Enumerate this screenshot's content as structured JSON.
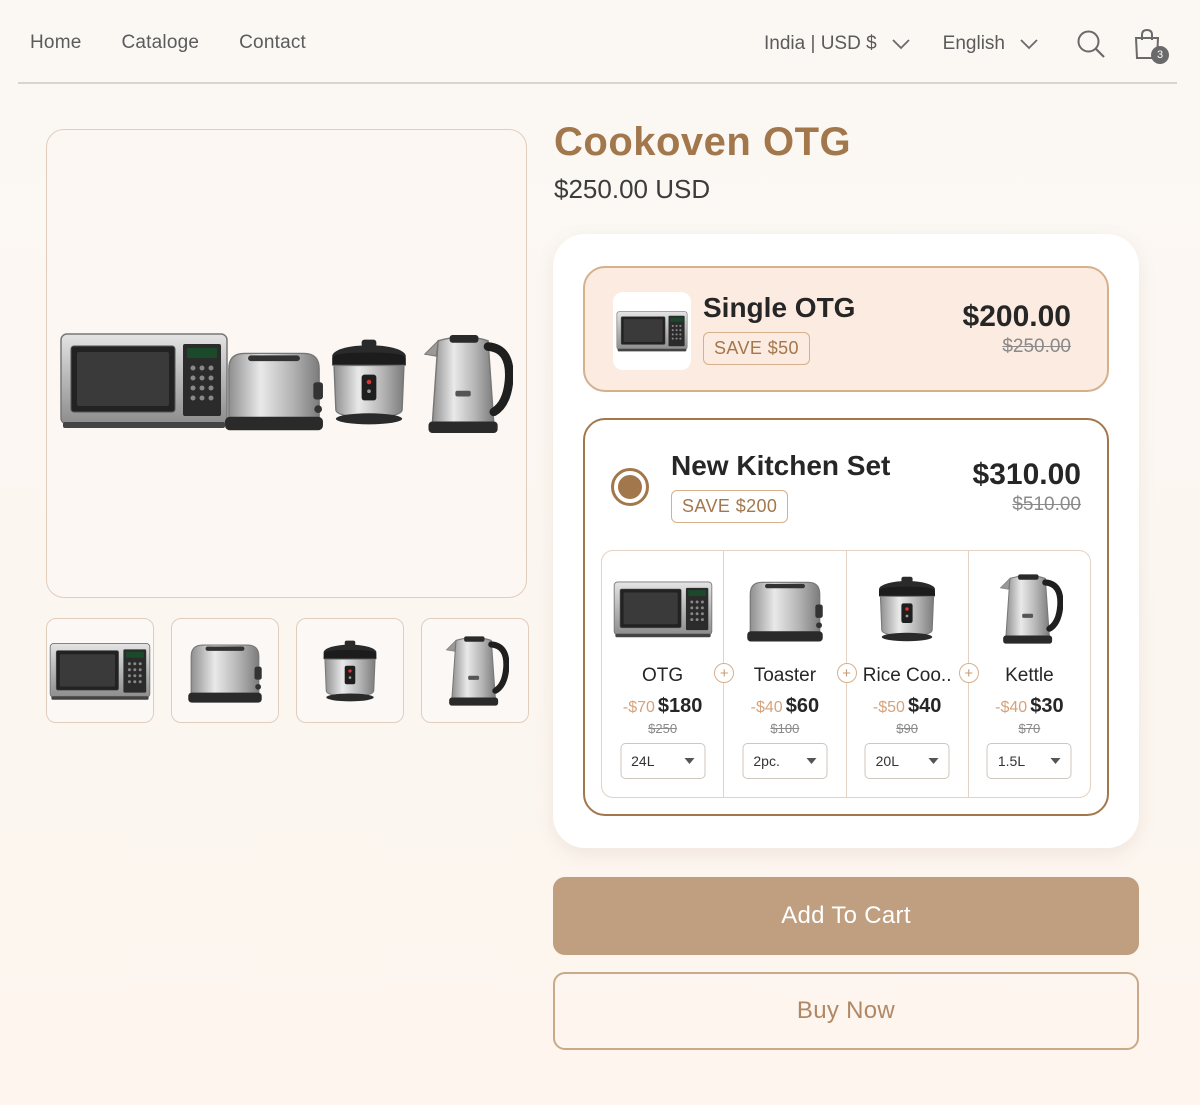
{
  "nav": {
    "items": [
      "Home",
      "Cataloge",
      "Contact"
    ]
  },
  "header": {
    "currency": "India | USD $",
    "language": "English",
    "cart_count": "3",
    "icons": {
      "search": "search-icon",
      "cart": "shopping-bag-icon",
      "chevron": "chevron-down-icon"
    }
  },
  "product": {
    "title": "Cookoven OTG",
    "price": "$250.00 USD"
  },
  "options": {
    "single": {
      "name": "Single OTG",
      "save": "SAVE $50",
      "price": "$200.00",
      "old_price": "$250.00",
      "selected": false
    },
    "bundle": {
      "name": "New Kitchen Set",
      "save": "SAVE $200",
      "price": "$310.00",
      "old_price": "$510.00",
      "selected": true,
      "items": [
        {
          "name": "OTG",
          "discount": "-$70",
          "price": "$180",
          "old_price": "$250",
          "variant": "24L"
        },
        {
          "name": "Toaster",
          "discount": "-$40",
          "price": "$60",
          "old_price": "$100",
          "variant": "2pc."
        },
        {
          "name": "Rice Coo..",
          "discount": "-$50",
          "price": "$40",
          "old_price": "$90",
          "variant": "20L"
        },
        {
          "name": "Kettle",
          "discount": "-$40",
          "price": "$30",
          "old_price": "$70",
          "variant": "1.5L"
        }
      ]
    }
  },
  "actions": {
    "add_to_cart": "Add To Cart",
    "buy_now": "Buy Now"
  },
  "colors": {
    "accent": "#a2774c",
    "button": "#bf9f7f",
    "background": "#fdf6f0",
    "selected_option": "#fcebe0"
  }
}
